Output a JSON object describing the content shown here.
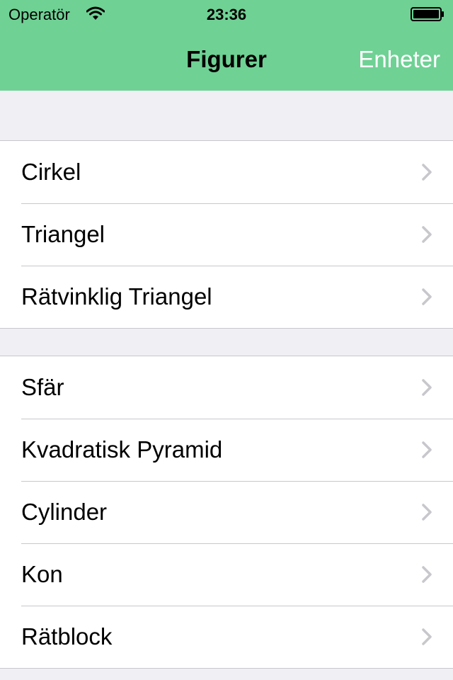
{
  "status_bar": {
    "carrier": "Operatör",
    "time": "23:36",
    "wifi_icon": "wifi-icon",
    "battery_icon": "battery-icon"
  },
  "nav_bar": {
    "title": "Figurer",
    "right_button": "Enheter",
    "background_color": "#6fd194"
  },
  "sections": [
    {
      "items": [
        {
          "label": "Cirkel",
          "icon": "chevron-right-icon"
        },
        {
          "label": "Triangel",
          "icon": "chevron-right-icon"
        },
        {
          "label": "Rätvinklig Triangel",
          "icon": "chevron-right-icon"
        }
      ]
    },
    {
      "items": [
        {
          "label": "Sfär",
          "icon": "chevron-right-icon"
        },
        {
          "label": "Kvadratisk Pyramid",
          "icon": "chevron-right-icon"
        },
        {
          "label": "Cylinder",
          "icon": "chevron-right-icon"
        },
        {
          "label": "Kon",
          "icon": "chevron-right-icon"
        },
        {
          "label": "Rätblock",
          "icon": "chevron-right-icon"
        }
      ]
    }
  ]
}
